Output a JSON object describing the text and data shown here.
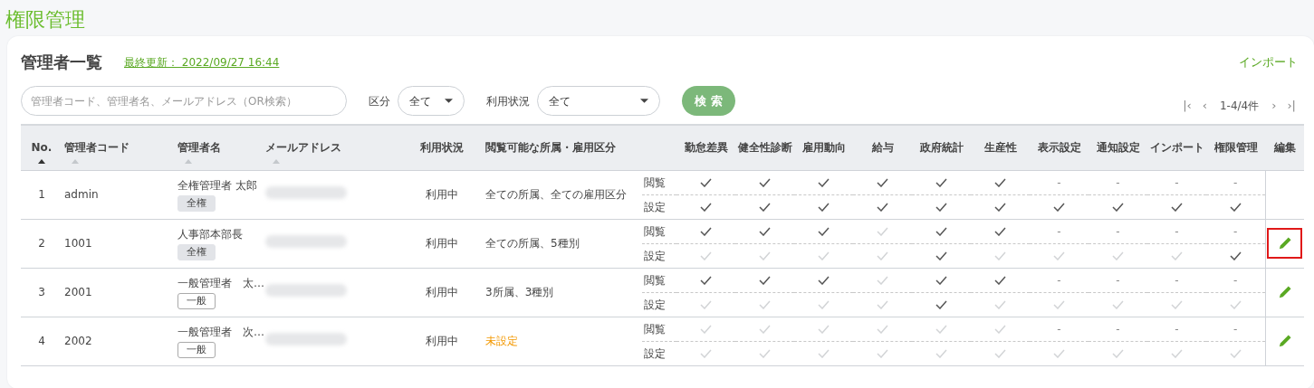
{
  "page_title": "権限管理",
  "card": {
    "title": "管理者一覧",
    "last_updated": "最終更新： 2022/09/27 16:44",
    "import_link": "インポート"
  },
  "filters": {
    "search": {
      "placeholder": "管理者コード、管理者名、メールアドレス（OR検索）"
    },
    "category": {
      "label": "区分",
      "value": "全て"
    },
    "usage": {
      "label": "利用状況",
      "value": "全て"
    },
    "search_button": "検 索"
  },
  "pagination": {
    "first": "|‹",
    "prev": "‹",
    "range": "1-4/4件",
    "next": "›",
    "last": "›|"
  },
  "table": {
    "columns": [
      {
        "label": "No.",
        "sortable": true,
        "sorted": true
      },
      {
        "label": "管理者コード",
        "sortable": true,
        "sorted": false
      },
      {
        "label": "管理者名",
        "sortable": true,
        "sorted": false
      },
      {
        "label": "メールアドレス",
        "sortable": true,
        "sorted": false
      },
      {
        "label": "利用状況"
      },
      {
        "label": "閲覧可能な所属・雇用区分"
      }
    ],
    "permission_columns": [
      "勤怠差異",
      "健全性診断",
      "雇用動向",
      "給与",
      "政府統計",
      "生産性",
      "表示設定",
      "通知設定",
      "インポート",
      "権限管理"
    ],
    "edit_column": "編集",
    "rows": [
      {
        "no": "1",
        "code": "admin",
        "name": "全権管理者 太郎",
        "role": {
          "kind": "full",
          "label": "全権"
        },
        "status": "利用中",
        "scope": "全ての所属、全ての雇用区分",
        "scope_unset": false,
        "view_label": "閲覧",
        "set_label": "設定",
        "view": [
          true,
          true,
          true,
          true,
          true,
          true,
          "-",
          "-",
          "-",
          "-"
        ],
        "set": [
          true,
          true,
          true,
          true,
          true,
          true,
          true,
          true,
          true,
          true
        ],
        "editable": false
      },
      {
        "no": "2",
        "code": "1001",
        "name": "人事部本部長",
        "role": {
          "kind": "full",
          "label": "全権"
        },
        "status": "利用中",
        "scope": "全ての所属、5種別",
        "scope_unset": false,
        "view_label": "閲覧",
        "set_label": "設定",
        "view": [
          true,
          true,
          true,
          false,
          true,
          true,
          "-",
          "-",
          "-",
          "-"
        ],
        "set": [
          false,
          false,
          false,
          false,
          true,
          false,
          false,
          false,
          false,
          true
        ],
        "editable": true,
        "highlighted": true
      },
      {
        "no": "3",
        "code": "2001",
        "name": "一般管理者　太…",
        "role": {
          "kind": "general",
          "label": "一般"
        },
        "status": "利用中",
        "scope": "3所属、3種別",
        "scope_unset": false,
        "view_label": "閲覧",
        "set_label": "設定",
        "view": [
          true,
          true,
          true,
          false,
          true,
          true,
          "-",
          "-",
          "-",
          "-"
        ],
        "set": [
          false,
          false,
          false,
          false,
          true,
          false,
          false,
          false,
          false,
          false
        ],
        "editable": true,
        "highlighted": false
      },
      {
        "no": "4",
        "code": "2002",
        "name": "一般管理者　次…",
        "role": {
          "kind": "general",
          "label": "一般"
        },
        "status": "利用中",
        "scope": "未設定",
        "scope_unset": true,
        "view_label": "閲覧",
        "set_label": "設定",
        "view": [
          false,
          false,
          false,
          false,
          false,
          false,
          "-",
          "-",
          "-",
          "-"
        ],
        "set": [
          false,
          false,
          false,
          false,
          false,
          false,
          false,
          false,
          false,
          false
        ],
        "editable": true,
        "highlighted": false
      }
    ]
  }
}
